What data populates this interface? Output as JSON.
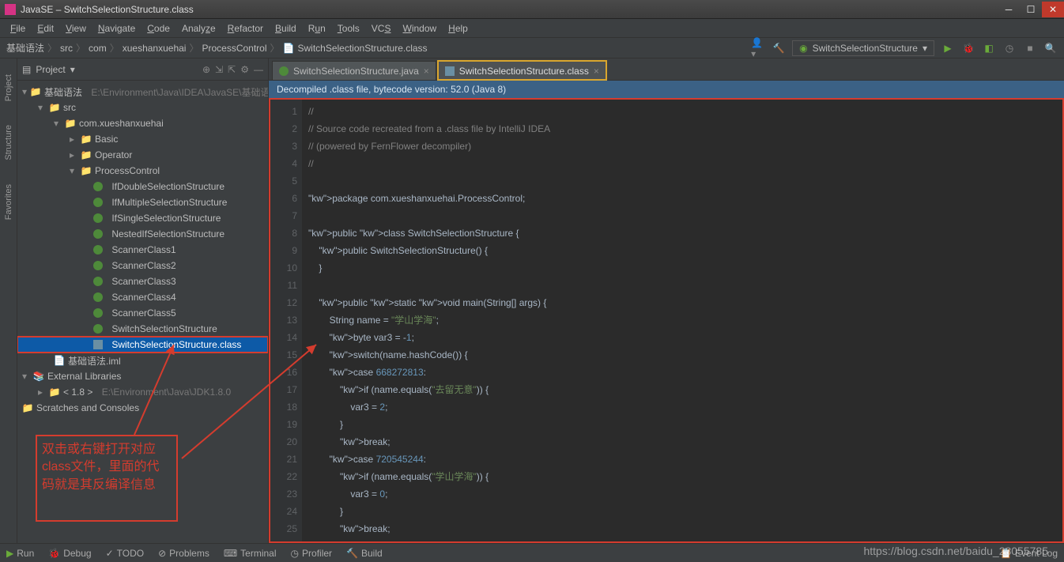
{
  "window": {
    "title": "JavaSE – SwitchSelectionStructure.class"
  },
  "menu": [
    "File",
    "Edit",
    "View",
    "Navigate",
    "Code",
    "Analyze",
    "Refactor",
    "Build",
    "Run",
    "Tools",
    "VCS",
    "Window",
    "Help"
  ],
  "breadcrumb": [
    "基础语法",
    "src",
    "com",
    "xueshanxuehai",
    "ProcessControl",
    "SwitchSelectionStructure.class"
  ],
  "run_config": "SwitchSelectionStructure",
  "sidebar": {
    "title": "Project",
    "root": {
      "label": "基础语法",
      "path": "E:\\Environment\\Java\\IDEA\\JavaSE\\基础语"
    },
    "src": "src",
    "pkg": "com.xueshanxuehai",
    "folders": [
      "Basic",
      "Operator"
    ],
    "pc_folder": "ProcessControl",
    "classes": [
      "IfDoubleSelectionStructure",
      "IfMultipleSelectionStructure",
      "IfSingleSelectionStructure",
      "NestedIfSelectionStructure",
      "ScannerClass1",
      "ScannerClass2",
      "ScannerClass3",
      "ScannerClass4",
      "ScannerClass5",
      "SwitchSelectionStructure"
    ],
    "selected_file": "SwitchSelectionStructure.class",
    "iml": "基础语法.iml",
    "ext_lib": "External Libraries",
    "jdk": "< 1.8 >",
    "jdk_path": "E:\\Environment\\Java\\JDK1.8.0",
    "scratches": "Scratches and Consoles"
  },
  "left_rail": [
    "Project",
    "Structure",
    "Favorites"
  ],
  "tabs": [
    {
      "label": "SwitchSelectionStructure.java",
      "active": false
    },
    {
      "label": "SwitchSelectionStructure.class",
      "active": true,
      "boxed": true
    }
  ],
  "banner": "Decompiled .class file, bytecode version: 52.0 (Java 8)",
  "code": {
    "lines": [
      {
        "n": 1,
        "t": "//",
        "cls": "cm"
      },
      {
        "n": 2,
        "t": "// Source code recreated from a .class file by IntelliJ IDEA",
        "cls": "cm"
      },
      {
        "n": 3,
        "t": "// (powered by FernFlower decompiler)",
        "cls": "cm"
      },
      {
        "n": 4,
        "t": "//",
        "cls": "cm"
      },
      {
        "n": 5,
        "t": "",
        "cls": ""
      },
      {
        "n": 6,
        "t": "package com.xueshanxuehai.ProcessControl;",
        "cls": "kwline"
      },
      {
        "n": 7,
        "t": "",
        "cls": ""
      },
      {
        "n": 8,
        "t": "public class SwitchSelectionStructure {",
        "cls": "kwline"
      },
      {
        "n": 9,
        "t": "    public SwitchSelectionStructure() {",
        "cls": "kwline"
      },
      {
        "n": 10,
        "t": "    }",
        "cls": ""
      },
      {
        "n": 11,
        "t": "",
        "cls": "cur"
      },
      {
        "n": 12,
        "t": "    public static void main(String[] args) {",
        "cls": "kwline"
      },
      {
        "n": 13,
        "t": "        String name = \"学山学海\";",
        "cls": "strline"
      },
      {
        "n": 14,
        "t": "        byte var3 = -1;",
        "cls": "numline"
      },
      {
        "n": 15,
        "t": "        switch(name.hashCode()) {",
        "cls": "kwline"
      },
      {
        "n": 16,
        "t": "        case 668272813:",
        "cls": "numline"
      },
      {
        "n": 17,
        "t": "            if (name.equals(\"去留无意\")) {",
        "cls": "strline"
      },
      {
        "n": 18,
        "t": "                var3 = 2;",
        "cls": "numline"
      },
      {
        "n": 19,
        "t": "            }",
        "cls": ""
      },
      {
        "n": 20,
        "t": "            break;",
        "cls": "kwline"
      },
      {
        "n": 21,
        "t": "        case 720545244:",
        "cls": "numline"
      },
      {
        "n": 22,
        "t": "            if (name.equals(\"学山学海\")) {",
        "cls": "strline"
      },
      {
        "n": 23,
        "t": "                var3 = 0;",
        "cls": "numline"
      },
      {
        "n": 24,
        "t": "            }",
        "cls": ""
      },
      {
        "n": 25,
        "t": "            break;",
        "cls": "kwline"
      }
    ]
  },
  "callout_text": "双击或右键打开对应class文件，里面的代码就是其反编译信息",
  "bottom": {
    "items": [
      "Run",
      "Debug",
      "TODO",
      "Problems",
      "Terminal",
      "Profiler",
      "Build"
    ],
    "event_log": "Event Log"
  },
  "watermark": "https://blog.csdn.net/baidu_28055785"
}
